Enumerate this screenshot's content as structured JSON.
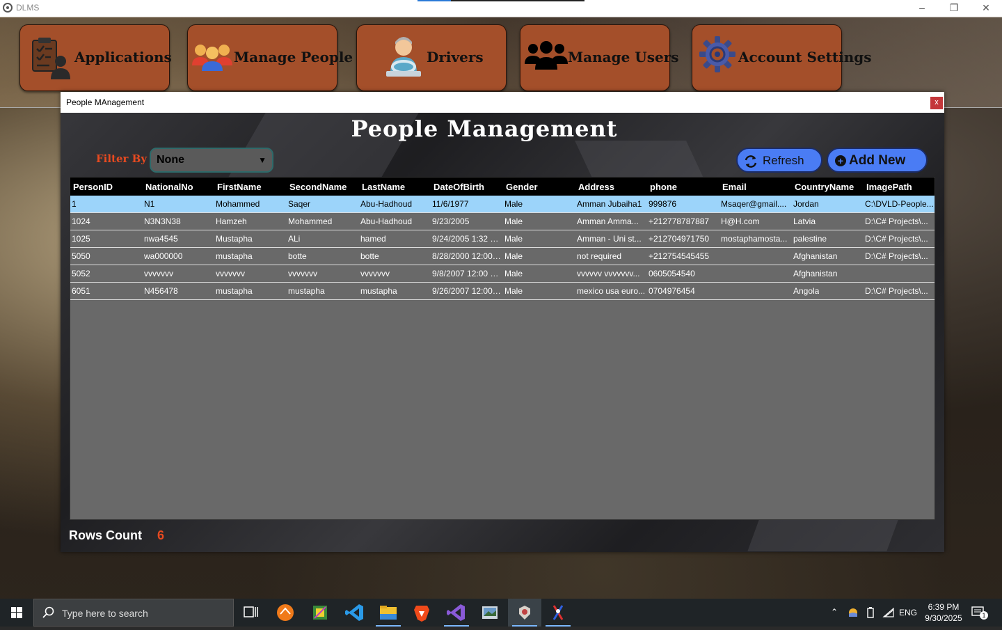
{
  "window": {
    "title": "DLMS",
    "controls": [
      "–",
      "❐",
      "✕"
    ]
  },
  "nav": [
    {
      "id": "applications",
      "label": "Applications",
      "icon": "clipboard-person-icon"
    },
    {
      "id": "people",
      "label": "Manage People",
      "icon": "people-group-icon"
    },
    {
      "id": "drivers",
      "label": "Drivers",
      "icon": "driver-icon"
    },
    {
      "id": "users",
      "label": "Manage Users",
      "icon": "users-group-icon"
    },
    {
      "id": "settings",
      "label": "Account Settings",
      "icon": "gear-icon"
    }
  ],
  "child_window": {
    "title": "People MAnagement",
    "close": "x"
  },
  "page": {
    "title": "People Management",
    "filter_label": "Filter By",
    "filter_value": "None",
    "refresh_label": "Refresh",
    "add_new_label": "Add New",
    "rows_count_label": "Rows Count",
    "rows_count_value": "6"
  },
  "table": {
    "columns": [
      "PersonID",
      "NationalNo",
      "FirstName",
      "SecondName",
      "LastName",
      "DateOfBirth",
      "Gender",
      "Address",
      "phone",
      "Email",
      "CountryName",
      "ImagePath"
    ],
    "rows": [
      [
        "1",
        "N1",
        "Mohammed",
        "Saqer",
        "Abu-Hadhoud",
        "11/6/1977",
        "Male",
        "Amman Jubaiha1",
        "999876",
        "Msaqer@gmail....",
        "Jordan",
        "C:\\DVLD-People..."
      ],
      [
        "1024",
        "N3N3N38",
        "Hamzeh",
        "Mohammed",
        "Abu-Hadhoud",
        "9/23/2005",
        "Male",
        "Amman Amma...",
        "+212778787887",
        "H@H.com",
        "Latvia",
        "D:\\C# Projects\\..."
      ],
      [
        "1025",
        "nwa4545",
        "Mustapha",
        "ALi",
        "hamed",
        "9/24/2005 1:32 PM",
        "Male",
        "Amman - Uni st...",
        "+212704971750",
        "mostaphamosta...",
        "palestine",
        "D:\\C# Projects\\..."
      ],
      [
        "5050",
        "wa000000",
        "mustapha",
        "botte",
        "botte",
        "8/28/2000 12:00 ...",
        "Male",
        "not required",
        "+212754545455",
        "",
        "Afghanistan",
        "D:\\C# Projects\\..."
      ],
      [
        "5052",
        "vvvvvvv",
        "vvvvvvv",
        "vvvvvvv",
        "vvvvvvv",
        "9/8/2007 12:00 PM",
        "Male",
        "vvvvvv vvvvvvv...",
        "0605054540",
        "",
        "Afghanistan",
        ""
      ],
      [
        "6051",
        "N456478",
        "mustapha",
        "mustapha",
        "mustapha",
        "9/26/2007 12:00 ...",
        "Male",
        "mexico usa euro...",
        "0704976454",
        "",
        "Angola",
        "D:\\C# Projects\\..."
      ]
    ],
    "selected_row": 0
  },
  "taskbar": {
    "search_placeholder": "Type here to search",
    "language": "ENG",
    "time": "6:39 PM",
    "date": "9/30/2025",
    "notification_count": "1",
    "apps": [
      "task-view-icon",
      "sublime-icon",
      "snipping-icon",
      "vscode-icon",
      "file-explorer-icon",
      "brave-icon",
      "visual-studio-icon",
      "photos-icon",
      "dlms-app-icon",
      "paint-icon"
    ]
  },
  "colors": {
    "nav_button": "#a44f2a",
    "accent_orange": "#e84a20",
    "action_button": "#4a7cf4",
    "selected_row": "#9cd4fa",
    "grid_body": "#696969"
  }
}
